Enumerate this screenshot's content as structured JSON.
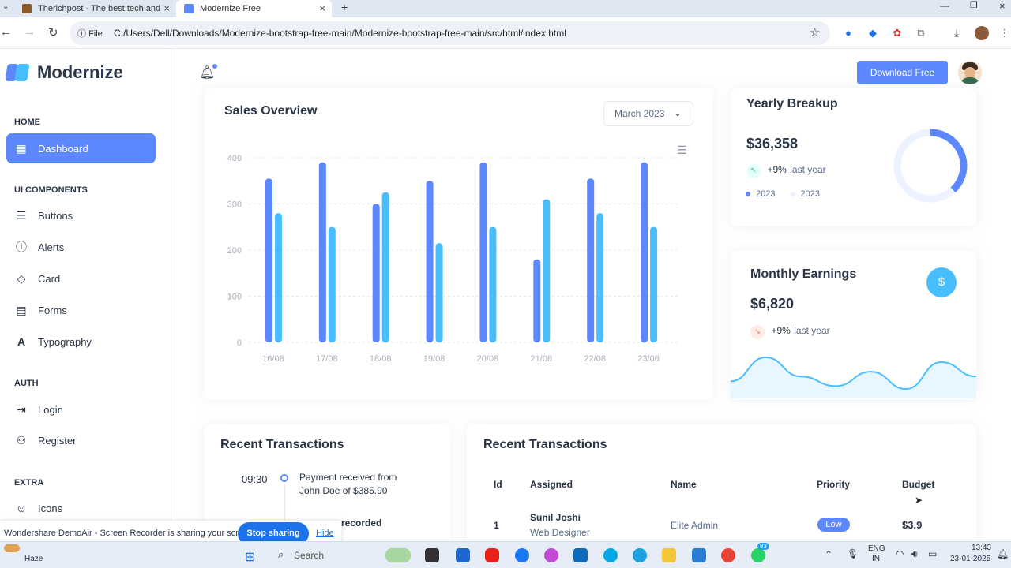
{
  "browser": {
    "tabs": [
      {
        "label": "Therichpost - The best tech and",
        "active": false
      },
      {
        "label": "Modernize Free",
        "active": true
      }
    ],
    "new_tab": "+",
    "file_label": "File",
    "url": "C:/Users/Dell/Downloads/Modernize-bootstrap-free-main/Modernize-bootstrap-free-main/src/html/index.html"
  },
  "brand": {
    "name": "Modernize",
    "primary": "#5d87ff",
    "secondary": "#49beff"
  },
  "sidebar": {
    "sections": [
      {
        "title": "HOME",
        "items": [
          {
            "label": "Dashboard",
            "icon": "layout-dashboard-icon",
            "active": true
          }
        ]
      },
      {
        "title": "UI COMPONENTS",
        "items": [
          {
            "label": "Buttons",
            "icon": "article-icon"
          },
          {
            "label": "Alerts",
            "icon": "alert-circle-icon"
          },
          {
            "label": "Card",
            "icon": "cards-icon"
          },
          {
            "label": "Forms",
            "icon": "file-description-icon"
          },
          {
            "label": "Typography",
            "icon": "typography-icon"
          }
        ]
      },
      {
        "title": "AUTH",
        "items": [
          {
            "label": "Login",
            "icon": "login-icon"
          },
          {
            "label": "Register",
            "icon": "user-plus-icon"
          }
        ]
      },
      {
        "title": "EXTRA",
        "items": [
          {
            "label": "Icons",
            "icon": "mood-happy-icon"
          }
        ]
      }
    ]
  },
  "header": {
    "download_label": "Download Free"
  },
  "sales": {
    "title": "Sales Overview",
    "month": "March 2023",
    "chart_data": {
      "type": "bar",
      "categories": [
        "16/08",
        "17/08",
        "18/08",
        "19/08",
        "20/08",
        "21/08",
        "22/08",
        "23/08"
      ],
      "series": [
        {
          "color": "#5d87ff",
          "values": [
            355,
            390,
            300,
            350,
            390,
            180,
            355,
            390
          ]
        },
        {
          "color": "#49beff",
          "values": [
            280,
            250,
            325,
            215,
            250,
            310,
            280,
            250
          ]
        }
      ],
      "ylim": [
        0,
        400
      ],
      "yticks": [
        "0",
        "100",
        "200",
        "300",
        "400"
      ],
      "grid": true
    }
  },
  "yearly": {
    "title": "Yearly Breakup",
    "value": "$36,358",
    "change": "+9%",
    "change_suffix": "last year",
    "legend": [
      "2023",
      "2023"
    ],
    "donut_fraction": 0.38,
    "colors": [
      "#5d87ff",
      "#ecf2ff"
    ]
  },
  "monthly": {
    "title": "Monthly Earnings",
    "value": "$6,820",
    "change": "+9%",
    "change_suffix": "last year",
    "dollar": "$",
    "sparkline": [
      30,
      55,
      35,
      25,
      40,
      22,
      50,
      35
    ]
  },
  "timeline": {
    "title": "Recent Transactions",
    "items": [
      {
        "time": "09:30",
        "text": "Payment received from John Doe of $385.90"
      },
      {
        "time": "",
        "text": "recorded"
      }
    ]
  },
  "table": {
    "title": "Recent Transactions",
    "headers": [
      "Id",
      "Assigned",
      "Name",
      "Priority",
      "Budget"
    ],
    "rows": [
      {
        "id": "1",
        "assigned": "Sunil Joshi",
        "role": "Web Designer",
        "name": "Elite Admin",
        "priority": "Low",
        "budget": "$3.9"
      }
    ]
  },
  "share": {
    "message": "Wondershare DemoAir - Screen Recorder is sharing your screen.",
    "stop": "Stop sharing",
    "hide": "Hide"
  },
  "taskbar": {
    "weather": "Haze",
    "search": "Search",
    "lang1": "ENG",
    "lang2": "IN",
    "time": "13:43",
    "date": "23-01-2025",
    "badge": "83"
  }
}
